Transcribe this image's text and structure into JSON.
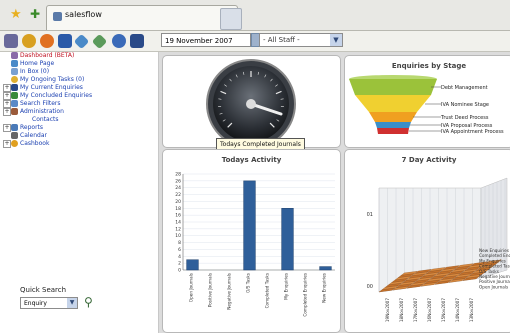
{
  "browser": {
    "tab_title": "salesflow"
  },
  "toolbar": {
    "date": "19 November 2007",
    "staff_filter": "- All Staff -"
  },
  "sidebar": {
    "items": [
      {
        "label": "Dashboard (BETA)",
        "color": "red"
      },
      {
        "label": "Home Page"
      },
      {
        "label": "In Box (0)"
      },
      {
        "label": "My Ongoing Tasks (0)"
      },
      {
        "label": "My Current Enquiries"
      },
      {
        "label": "My Concluded Enquiries"
      },
      {
        "label": "Search Filters"
      },
      {
        "label": "Administration"
      },
      {
        "label": "Contacts"
      },
      {
        "label": "Reports"
      },
      {
        "label": "Calendar"
      },
      {
        "label": "Cashbook"
      }
    ],
    "quick_search_label": "Quick Search",
    "quick_search_value": "Enquiry"
  },
  "gauge": {
    "tooltip": "Todays Completed Journals"
  },
  "funnel": {
    "title": "Enquiries by Stage",
    "stages": [
      {
        "label": "Debt Management",
        "color": "#9bc23a"
      },
      {
        "label": "IVA Nominee Stage",
        "color": "#f0d030"
      },
      {
        "label": "Trust Deed Process",
        "color": "#f0a020"
      },
      {
        "label": "IVA Proposal Process",
        "color": "#3a8ec8"
      },
      {
        "label": "IVA Appointment Process",
        "color": "#d03030"
      }
    ]
  },
  "chart_data": [
    {
      "type": "bar",
      "title": "Todays Activity",
      "categories": [
        "Open Journals",
        "Positive Journals",
        "Negative Journals",
        "O/S Tasks",
        "Completed Tasks",
        "My Enquiries",
        "Completed Enquiries",
        "New Enquiries"
      ],
      "values": [
        3,
        0,
        0,
        26,
        0,
        18,
        0,
        1
      ],
      "yticks": [
        0,
        2,
        4,
        6,
        8,
        10,
        12,
        14,
        16,
        18,
        20,
        22,
        24,
        26,
        28
      ],
      "ylim": [
        0,
        28
      ],
      "color": "#2f5f9a"
    },
    {
      "type": "bar",
      "title": "7 Day Activity",
      "y_tick_labels": [
        "01",
        "00"
      ],
      "x_labels": [
        "19Nov2007",
        "18Nov2007",
        "17Nov2007",
        "16Nov2007",
        "15Nov2007",
        "14Nov2007",
        "13Nov2007"
      ],
      "depth_labels": [
        "New Enquiries",
        "Completed Enquiries",
        "My Enquiries",
        "Completed Tasks",
        "O/S Tasks",
        "Negative Journals",
        "Positive Journals",
        "Open Journals"
      ]
    }
  ]
}
